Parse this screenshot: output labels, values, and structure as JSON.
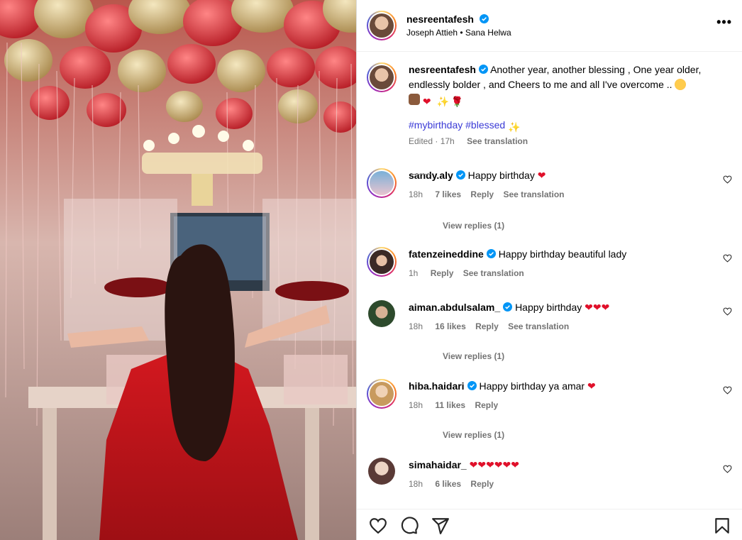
{
  "header": {
    "username": "nesreentafesh",
    "subtitle": "Joseph Attieh • Sana Helwa",
    "more_icon": "more-horizontal-icon"
  },
  "caption": {
    "username": "nesreentafesh",
    "text": "Another year, another blessing , One year older, endlessly bolder , and Cheers to me and all I've overcome ..",
    "hashtags": "#mybirthday #blessed",
    "time": "Edited · 17h",
    "see_translation": "See translation"
  },
  "comments": [
    {
      "username": "sandy.aly",
      "text": "Happy birthday",
      "time": "18h",
      "likes": "7 likes",
      "reply": "Reply",
      "see_translation": "See translation",
      "view_replies": "View replies (1)"
    },
    {
      "username": "fatenzeineddine",
      "text": "Happy birthday beautiful lady",
      "time": "1h",
      "likes": "",
      "reply": "Reply",
      "see_translation": "See translation",
      "view_replies": ""
    },
    {
      "username": "aiman.abdulsalam_",
      "text": "Happy birthday",
      "time": "18h",
      "likes": "16 likes",
      "reply": "Reply",
      "see_translation": "See translation",
      "view_replies": "View replies (1)"
    },
    {
      "username": "hiba.haidari",
      "text": "Happy birthday ya amar",
      "time": "18h",
      "likes": "11 likes",
      "reply": "Reply",
      "see_translation": "",
      "view_replies": "View replies (1)"
    },
    {
      "username": "simahaidar_",
      "text": "",
      "time": "18h",
      "likes": "6 likes",
      "reply": "Reply",
      "see_translation": "",
      "view_replies": ""
    }
  ],
  "actions": [
    "heart-icon",
    "comment-icon",
    "share-icon",
    "bookmark-icon"
  ],
  "colors": {
    "verified": "#0095f6",
    "heart": "#e0102a",
    "link": "#00376b",
    "hashtag": "#3a3ad6"
  }
}
